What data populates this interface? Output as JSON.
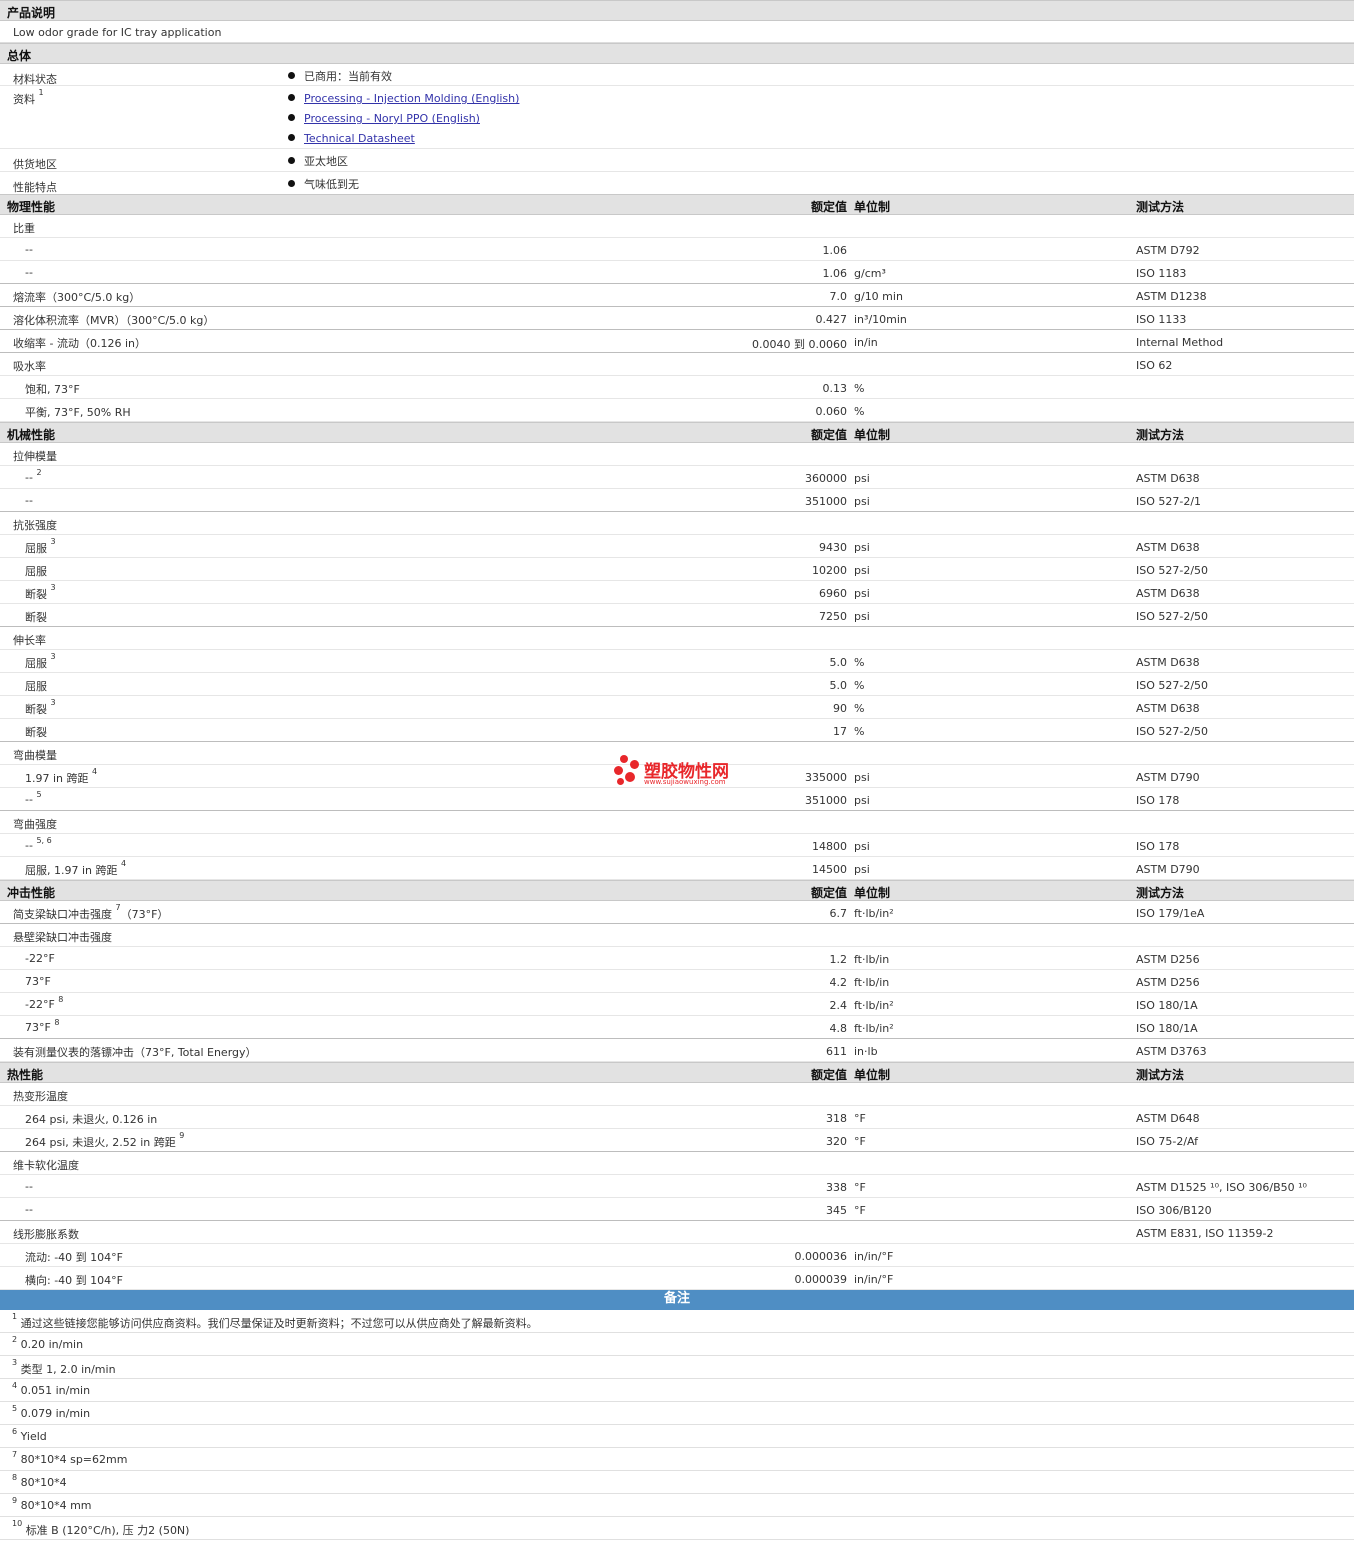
{
  "product_description": {
    "title": "产品说明",
    "text": "Low odor grade for IC tray application"
  },
  "general": {
    "title": "总体",
    "material_status": {
      "label": "材料状态",
      "value": "已商用：当前有效"
    },
    "documents": {
      "label": "资料",
      "sup": "1",
      "links": [
        "Processing - Injection Molding (English)",
        "Processing - Noryl PPO (English)",
        "Technical Datasheet"
      ]
    },
    "availability": {
      "label": "供货地区",
      "value": "亚太地区"
    },
    "features": {
      "label": "性能特点",
      "value": "气味低到无"
    }
  },
  "columns": {
    "value": "额定值",
    "unit": "单位制",
    "method": "测试方法"
  },
  "sections": [
    {
      "title": "物理性能",
      "rows": [
        {
          "n": "比重",
          "sup": "",
          "v": "",
          "u": "",
          "m": ""
        },
        {
          "n": "--",
          "sup": "",
          "v": "1.06",
          "u": "",
          "m": "ASTM D792",
          "sub": true
        },
        {
          "n": "--",
          "sup": "",
          "v": "1.06",
          "u": "g/cm³",
          "m": "ISO 1183",
          "sub": true,
          "last": true
        },
        {
          "n": "熔流率（300°C/5.0 kg）",
          "sup": "",
          "v": "7.0",
          "u": "g/10 min",
          "m": "ASTM D1238",
          "last": true
        },
        {
          "n": "溶化体积流率（MVR）（300°C/5.0 kg）",
          "sup": "",
          "v": "0.427",
          "u": "in³/10min",
          "m": "ISO 1133",
          "last": true
        },
        {
          "n": "收缩率 - 流动（0.126 in）",
          "sup": "",
          "v": "0.0040 到 0.0060",
          "u": "in/in",
          "m": "Internal Method",
          "last": true
        },
        {
          "n": "吸水率",
          "sup": "",
          "v": "",
          "u": "",
          "m": "ISO 62"
        },
        {
          "n": "饱和, 73°F",
          "sup": "",
          "v": "0.13",
          "u": "%",
          "m": "",
          "sub": true
        },
        {
          "n": "平衡, 73°F, 50% RH",
          "sup": "",
          "v": "0.060",
          "u": "%",
          "m": "",
          "sub": true
        }
      ]
    },
    {
      "title": "机械性能",
      "rows": [
        {
          "n": "拉伸模量",
          "sup": "",
          "v": "",
          "u": "",
          "m": ""
        },
        {
          "n": "--",
          "sup": "2",
          "v": "360000",
          "u": "psi",
          "m": "ASTM D638",
          "sub": true
        },
        {
          "n": "--",
          "sup": "",
          "v": "351000",
          "u": "psi",
          "m": "ISO 527-2/1",
          "sub": true,
          "last": true
        },
        {
          "n": "抗张强度",
          "sup": "",
          "v": "",
          "u": "",
          "m": ""
        },
        {
          "n": "屈服",
          "sup": "3",
          "v": "9430",
          "u": "psi",
          "m": "ASTM D638",
          "sub": true
        },
        {
          "n": "屈服",
          "sup": "",
          "v": "10200",
          "u": "psi",
          "m": "ISO 527-2/50",
          "sub": true
        },
        {
          "n": "断裂",
          "sup": "3",
          "v": "6960",
          "u": "psi",
          "m": "ASTM D638",
          "sub": true
        },
        {
          "n": "断裂",
          "sup": "",
          "v": "7250",
          "u": "psi",
          "m": "ISO 527-2/50",
          "sub": true,
          "last": true
        },
        {
          "n": "伸长率",
          "sup": "",
          "v": "",
          "u": "",
          "m": ""
        },
        {
          "n": "屈服",
          "sup": "3",
          "v": "5.0",
          "u": "%",
          "m": "ASTM D638",
          "sub": true
        },
        {
          "n": "屈服",
          "sup": "",
          "v": "5.0",
          "u": "%",
          "m": "ISO 527-2/50",
          "sub": true
        },
        {
          "n": "断裂",
          "sup": "3",
          "v": "90",
          "u": "%",
          "m": "ASTM D638",
          "sub": true
        },
        {
          "n": "断裂",
          "sup": "",
          "v": "17",
          "u": "%",
          "m": "ISO 527-2/50",
          "sub": true,
          "last": true
        },
        {
          "n": "弯曲模量",
          "sup": "",
          "v": "",
          "u": "",
          "m": ""
        },
        {
          "n": "1.97 in 跨距",
          "sup": "4",
          "v": "335000",
          "u": "psi",
          "m": "ASTM D790",
          "sub": true
        },
        {
          "n": "--",
          "sup": "5",
          "v": "351000",
          "u": "psi",
          "m": "ISO 178",
          "sub": true,
          "last": true
        },
        {
          "n": "弯曲强度",
          "sup": "",
          "v": "",
          "u": "",
          "m": ""
        },
        {
          "n": "--",
          "sup": "5, 6",
          "v": "14800",
          "u": "psi",
          "m": "ISO 178",
          "sub": true
        },
        {
          "n": "屈服, 1.97 in 跨距",
          "sup": "4",
          "v": "14500",
          "u": "psi",
          "m": "ASTM D790",
          "sub": true
        }
      ]
    },
    {
      "title": "冲击性能",
      "rows": [
        {
          "n": "简支梁缺口冲击强度",
          "sup": "7",
          "tail": "（73°F）",
          "v": "6.7",
          "u": "ft·lb/in²",
          "m": "ISO 179/1eA",
          "last": true
        },
        {
          "n": "悬壁梁缺口冲击强度",
          "sup": "",
          "v": "",
          "u": "",
          "m": ""
        },
        {
          "n": "-22°F",
          "sup": "",
          "v": "1.2",
          "u": "ft·lb/in",
          "m": "ASTM D256",
          "sub": true
        },
        {
          "n": "73°F",
          "sup": "",
          "v": "4.2",
          "u": "ft·lb/in",
          "m": "ASTM D256",
          "sub": true
        },
        {
          "n": "-22°F",
          "sup": "8",
          "v": "2.4",
          "u": "ft·lb/in²",
          "m": "ISO 180/1A",
          "sub": true
        },
        {
          "n": "73°F",
          "sup": "8",
          "v": "4.8",
          "u": "ft·lb/in²",
          "m": "ISO 180/1A",
          "sub": true,
          "last": true
        },
        {
          "n": "装有测量仪表的落镖冲击（73°F, Total Energy）",
          "sup": "",
          "v": "611",
          "u": "in·lb",
          "m": "ASTM D3763"
        }
      ]
    },
    {
      "title": "热性能",
      "rows": [
        {
          "n": "热变形温度",
          "sup": "",
          "v": "",
          "u": "",
          "m": ""
        },
        {
          "n": "264 psi, 未退火, 0.126 in",
          "sup": "",
          "v": "318",
          "u": "°F",
          "m": "ASTM D648",
          "sub": true
        },
        {
          "n": "264 psi, 未退火, 2.52 in 跨距",
          "sup": "9",
          "v": "320",
          "u": "°F",
          "m": "ISO 75-2/Af",
          "sub": true,
          "last": true
        },
        {
          "n": "维卡软化温度",
          "sup": "",
          "v": "",
          "u": "",
          "m": ""
        },
        {
          "n": "--",
          "sup": "",
          "v": "338",
          "u": "°F",
          "m": "ASTM D1525 ¹⁰, ISO 306/B50 ¹⁰",
          "sub": true
        },
        {
          "n": "--",
          "sup": "",
          "v": "345",
          "u": "°F",
          "m": "ISO 306/B120",
          "sub": true,
          "last": true
        },
        {
          "n": "线形膨胀系数",
          "sup": "",
          "v": "",
          "u": "",
          "m": "ASTM E831, ISO 11359-2"
        },
        {
          "n": "流动: -40 到 104°F",
          "sup": "",
          "v": "0.000036",
          "u": "in/in/°F",
          "m": "",
          "sub": true
        },
        {
          "n": "横向: -40 到 104°F",
          "sup": "",
          "v": "0.000039",
          "u": "in/in/°F",
          "m": "",
          "sub": true
        }
      ]
    }
  ],
  "notes": {
    "title": "备注",
    "items": [
      {
        "sup": "1",
        "text": "通过这些链接您能够访问供应商资料。我们尽量保证及时更新资料；不过您可以从供应商处了解最新资料。"
      },
      {
        "sup": "2",
        "text": "0.20 in/min"
      },
      {
        "sup": "3",
        "text": "类型 1, 2.0 in/min"
      },
      {
        "sup": "4",
        "text": "0.051 in/min"
      },
      {
        "sup": "5",
        "text": "0.079 in/min"
      },
      {
        "sup": "6",
        "text": "Yield"
      },
      {
        "sup": "7",
        "text": "80*10*4 sp=62mm"
      },
      {
        "sup": "8",
        "text": "80*10*4"
      },
      {
        "sup": "9",
        "text": "80*10*4 mm"
      },
      {
        "sup": "10",
        "text": "标准 B (120°C/h), 压 力2 (50N)"
      }
    ]
  },
  "watermark": {
    "name": "塑胶物性网",
    "url": "www.sujiaowuxing.com"
  }
}
